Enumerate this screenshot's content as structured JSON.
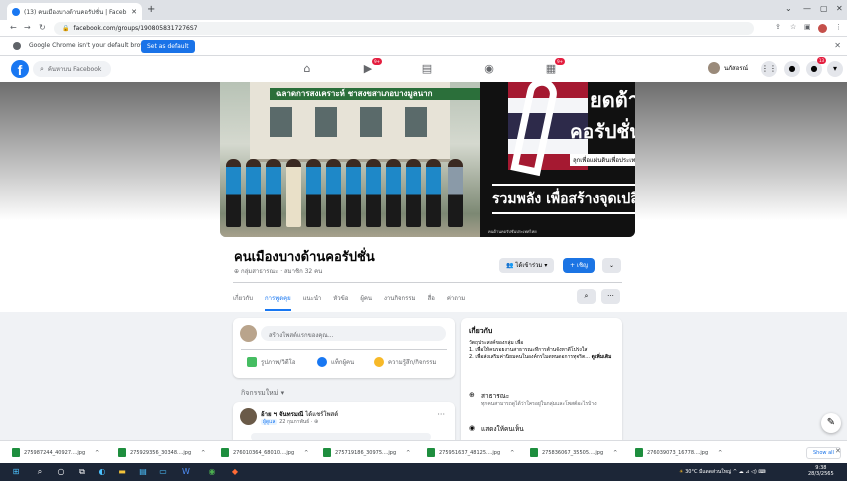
{
  "browser": {
    "tab_title": "(13) คนเมืองบางด้านคอรัปชั่น | Faceb",
    "url": "facebook.com/groups/1908058317276S7",
    "infobar_message": "Google Chrome isn't your default browser",
    "infobar_button": "Set as default"
  },
  "fb_nav": {
    "search_placeholder": "ค้นหาบน Facebook",
    "profile_name": "นภัสอรณ์",
    "badges": {
      "groups": "9+",
      "gaming": "9+",
      "messenger": "",
      "notifications": "13"
    }
  },
  "cover": {
    "sign_text": "ฉลาดการสงเคราะห์ ชาสงขสาเภอบางมูลนาก",
    "poster_top": "ยดต้าน",
    "poster_big": "คอรัปชั่น",
    "poster_sub": "ลุกเพื่อแผ่นดินเพื่อประเทศไทย",
    "poster_slogan": "รวมพลัง เพื่อสร้างจุดเปลี่ยน",
    "poster_footer": "คนต้านคอรัปชั่นประเทศไทย"
  },
  "group": {
    "name": "คนเมืองบางด้านคอรัปชั่น",
    "meta": "กลุ่มสาธารณะ · สมาชิก 32 คน",
    "joined_label": "ได้เข้าร่วม",
    "invite_label": "+ เชิญ",
    "tabs": [
      "เกี่ยวกับ",
      "การพูดคุย",
      "แนะนำ",
      "หัวข้อ",
      "ผู้คน",
      "งานกิจกรรม",
      "สื่อ",
      "ค่าถาม"
    ]
  },
  "composer": {
    "placeholder": "สร้างโพสต์แรกของคุณ...",
    "actions": [
      "รูปภาพ/วิดีโอ",
      "แท็กผู้คน",
      "ความรู้สึก/กิจกรรม"
    ]
  },
  "activity": {
    "label": "กิจกรรมใหม่ ▾",
    "post_author": "อ้าย ฯ จันทรมณี",
    "post_action": "ได้แชร์โพสต์",
    "post_tag": "ผู้ดูแล",
    "post_date": "22 กุมภาพันธ์ ·"
  },
  "about": {
    "title": "เกี่ยวกับ",
    "description": "วัตถุประสงค์ของกลุ่ม เพื่อ\n1. เพื่อให้คนรอยงานสาธารณะทีการต้านจังหาดีโปร่งใส\n2. เพื่อส่งเสริมค่านิยมคนในองค์กรไมดทนดอการทุจริต...",
    "see_more": "ดูเพิ่มเติม",
    "public_title": "สาธารณะ",
    "public_desc": "ทุกคนสามารถดูได้ว่าใครอยู่ในกลุ่มและโพสต์อะไรบ้าง",
    "visible_title": "แสดงให้คนเห็น"
  },
  "downloads": [
    "275987244_40927....jpg",
    "275929356_30348....jpg",
    "276010364_68010....jpg",
    "275719186_30975....jpg",
    "275951637_48125....jpg",
    "275836067_35505....jpg",
    "276039073_16778....jpg"
  ],
  "downloads_show_all": "Show all",
  "taskbar": {
    "weather": "30°C มีแดดส่วนใหญ่",
    "time": "9:38",
    "date": "28/3/2565"
  }
}
